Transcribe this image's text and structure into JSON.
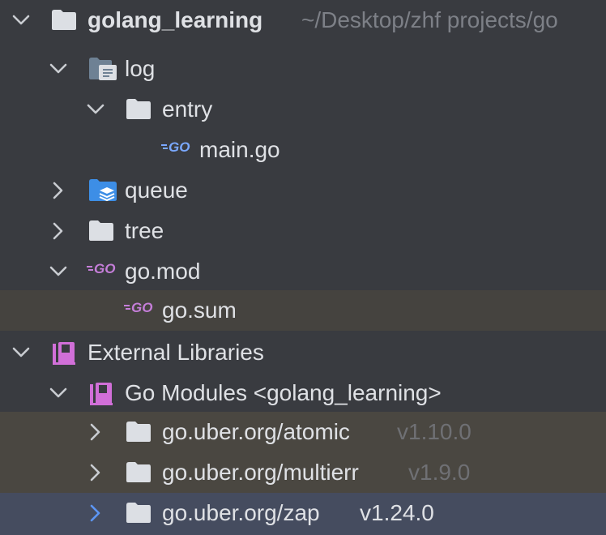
{
  "project": {
    "name": "golang_learning",
    "path": "~/Desktop/zhf projects/go"
  },
  "items": [
    {
      "label": "log"
    },
    {
      "label": "entry"
    },
    {
      "label": "main.go"
    },
    {
      "label": "queue"
    },
    {
      "label": "tree"
    },
    {
      "label": "go.mod"
    },
    {
      "label": "go.sum"
    }
  ],
  "external": {
    "label": "External Libraries",
    "go_modules": "Go Modules <golang_learning>",
    "modules": [
      {
        "name": "go.uber.org/atomic",
        "version": "v1.10.0"
      },
      {
        "name": "go.uber.org/multierr",
        "version": "v1.9.0"
      },
      {
        "name": "go.uber.org/zap",
        "version": "v1.24.0"
      }
    ]
  },
  "icons": {
    "folder": "folder-icon",
    "log_folder": "module-folder-icon",
    "queue_folder": "source-folder-icon",
    "go_file": "go-file-icon",
    "library": "library-icon"
  },
  "colors": {
    "background": "#393b40",
    "file_selected": "#45433f",
    "module_highlight": "#4a4741",
    "selected_row": "#454c5f",
    "folder": "#dcdfe4",
    "go_blue": "#7aa8ff",
    "go_purple": "#c57ed9",
    "library": "#d16fd8",
    "queue_folder": "#3d8ee6",
    "chevron_selected": "#5c96f5"
  }
}
